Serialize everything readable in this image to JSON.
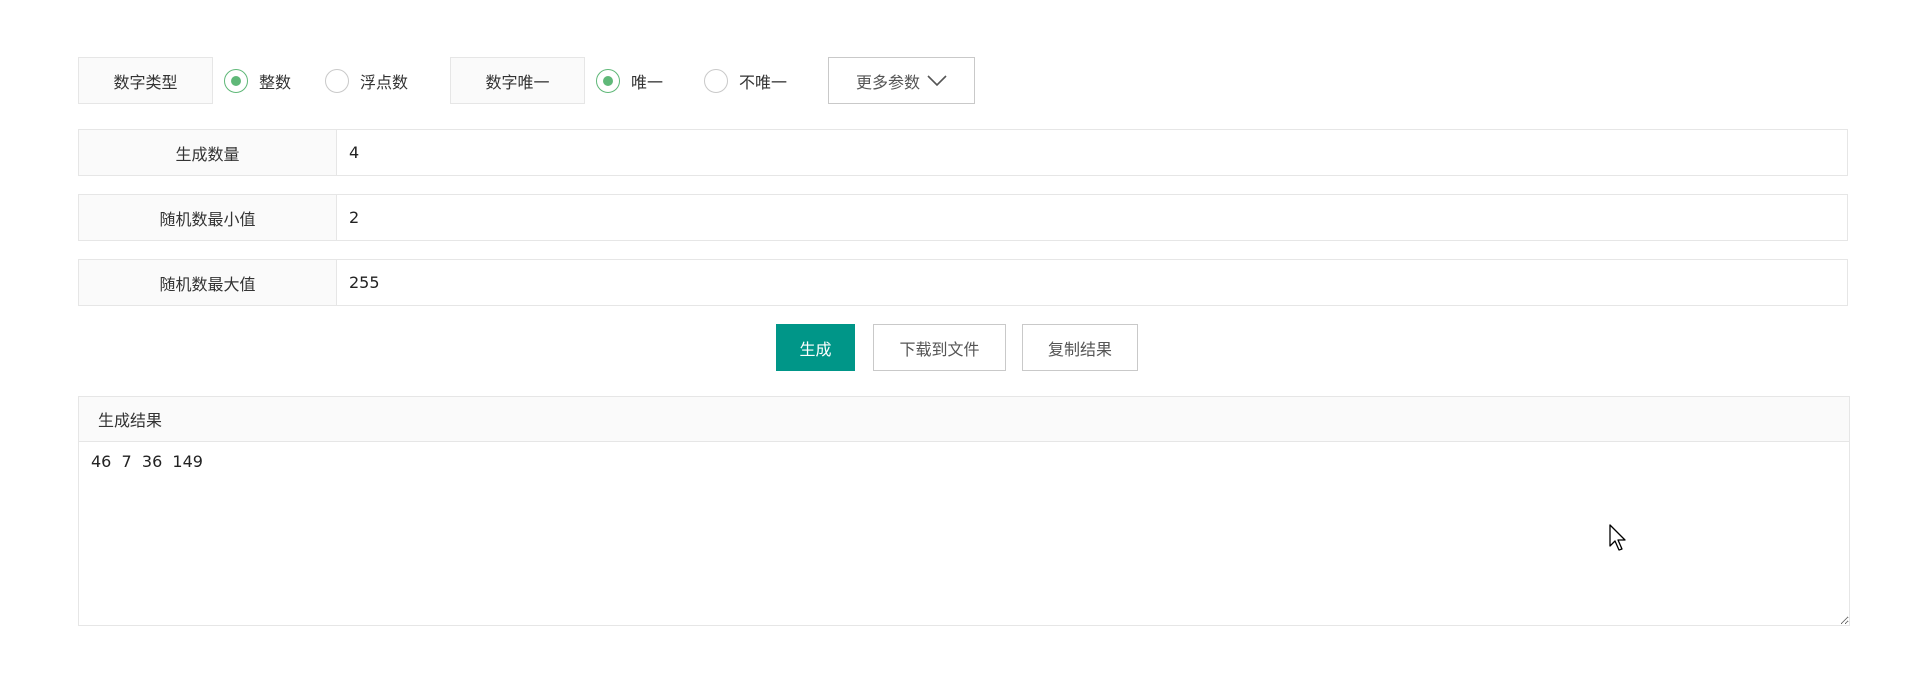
{
  "options": {
    "number_type": {
      "label": "数字类型",
      "choices": [
        {
          "label": "整数",
          "checked": true
        },
        {
          "label": "浮点数",
          "checked": false
        }
      ]
    },
    "uniqueness": {
      "label": "数字唯一",
      "choices": [
        {
          "label": "唯一",
          "checked": true
        },
        {
          "label": "不唯一",
          "checked": false
        }
      ]
    },
    "more_params": {
      "label": "更多参数",
      "icon": "chevron-down-icon"
    }
  },
  "params": [
    {
      "label": "生成数量",
      "value": "4"
    },
    {
      "label": "随机数最小值",
      "value": "2"
    },
    {
      "label": "随机数最大值",
      "value": "255"
    }
  ],
  "actions": {
    "generate": "生成",
    "download": "下载到文件",
    "copy": "复制结果"
  },
  "result": {
    "title": "生成结果",
    "text": "46  7  36  149"
  },
  "colors": {
    "primary": "#009688",
    "radio_checked": "#5fb878",
    "border": "#e6e6e6",
    "label_bg": "#fafafa"
  }
}
